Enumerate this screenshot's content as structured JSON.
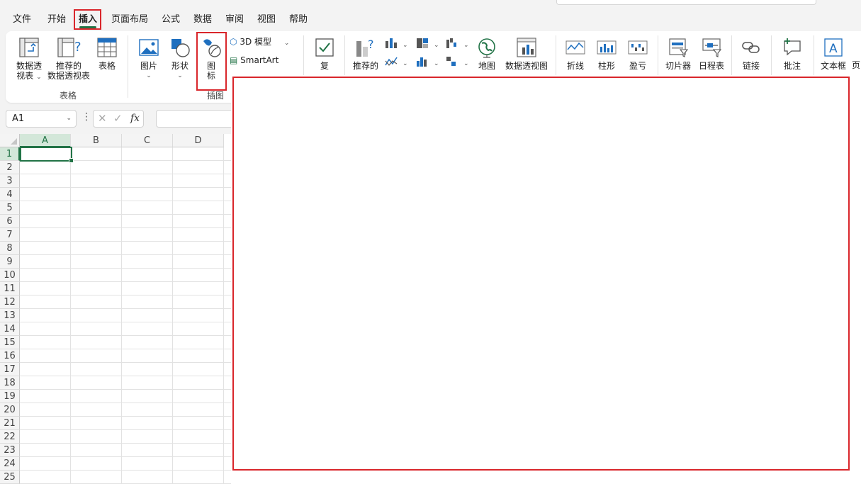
{
  "menu": {
    "tabs": [
      {
        "label": "文件"
      },
      {
        "label": "开始"
      },
      {
        "label": "插入"
      },
      {
        "label": "页面布局"
      },
      {
        "label": "公式"
      },
      {
        "label": "数据"
      },
      {
        "label": "审阅"
      },
      {
        "label": "视图"
      },
      {
        "label": "帮助"
      }
    ],
    "active_tab": "插入"
  },
  "ribbon": {
    "tables_group": {
      "label": "表格",
      "pivot_table_line1": "数据透",
      "pivot_table_line2": "视表",
      "recommended_pivot_line1": "推荐的",
      "recommended_pivot_line2": "数据透视表",
      "table": "表格"
    },
    "illustrations_group": {
      "label": "插图",
      "pictures": "图片",
      "shapes": "形状",
      "icons_line1": "图",
      "icons_line2": "标",
      "model_3d": "3D 模型",
      "smartart": "SmartArt"
    },
    "checkbox": "复",
    "recommended_charts": "推荐的",
    "map": "地图",
    "pivot_chart": "数据透视图",
    "sparkline_line": "折线",
    "sparkline_column": "柱形",
    "sparkline_winloss": "盈亏",
    "slicer": "切片器",
    "timeline": "日程表",
    "link": "链接",
    "comment": "批注",
    "textbox": "文本框",
    "more": "页"
  },
  "formula_bar": {
    "name_box": "A1",
    "fx_label": "fx"
  },
  "sheet": {
    "columns": [
      "A",
      "B",
      "C",
      "D"
    ],
    "rows": [
      "1",
      "2",
      "3",
      "4",
      "5",
      "6",
      "7",
      "8",
      "9",
      "10",
      "11",
      "12",
      "13",
      "14",
      "15",
      "16",
      "17",
      "18",
      "19",
      "20",
      "21",
      "22",
      "23",
      "24",
      "25"
    ],
    "active_cell": "A1"
  },
  "colors": {
    "accent": "#217346",
    "highlight": "#d9262b"
  }
}
